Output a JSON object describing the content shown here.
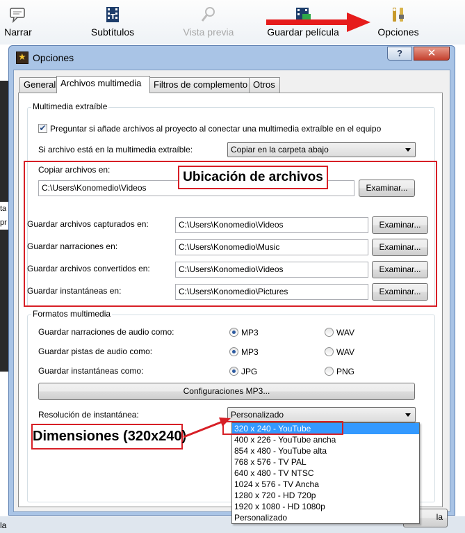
{
  "toolbar": {
    "narrar": "Narrar",
    "subtitulos": "Subtítulos",
    "vista_previa": "Vista previa",
    "guardar_pelicula": "Guardar película",
    "opciones": "Opciones"
  },
  "background": {
    "left_text": "ta\npr",
    "bottom_text": "la",
    "ok_partial": "la"
  },
  "dialog": {
    "title": "Opciones",
    "help": "?",
    "close": "✕",
    "tabs": [
      "General",
      "Archivos multimedia",
      "Filtros de complemento",
      "Otros"
    ],
    "removable": {
      "legend": "Multimedia extraíble",
      "ask_checkbox_label": "Preguntar si añade archivos al proyecto al conectar una multimedia extraíble en el equipo",
      "ask_checked": true,
      "if_file_label": "Si archivo está en la multimedia extraíble:",
      "if_file_value": "Copiar en la carpeta abajo",
      "copy_to_label": "Copiar archivos en:",
      "copy_to_value": "C:\\Users\\Konomedio\\Videos",
      "browse": "Examinar..."
    },
    "paths": [
      {
        "label": "Guardar archivos capturados en:",
        "value": "C:\\Users\\Konomedio\\Videos",
        "browse": "Examinar..."
      },
      {
        "label": "Guardar narraciones en:",
        "value": "C:\\Users\\Konomedio\\Music",
        "browse": "Examinar..."
      },
      {
        "label": "Guardar archivos convertidos en:",
        "value": "C:\\Users\\Konomedio\\Videos",
        "browse": "Examinar..."
      },
      {
        "label": "Guardar instantáneas en:",
        "value": "C:\\Users\\Konomedio\\Pictures",
        "browse": "Examinar..."
      }
    ],
    "formats": {
      "legend": "Formatos multimedia",
      "rows": [
        {
          "label": "Guardar narraciones de audio como:",
          "opt1": "MP3",
          "opt2": "WAV",
          "selected": "opt1"
        },
        {
          "label": "Guardar pistas de audio como:",
          "opt1": "MP3",
          "opt2": "WAV",
          "selected": "opt1"
        },
        {
          "label": "Guardar instantáneas como:",
          "opt1": "JPG",
          "opt2": "PNG",
          "selected": "opt1"
        }
      ],
      "mp3_settings": "Configuraciones MP3...",
      "resolution_label": "Resolución de instantánea:",
      "resolution_value": "Personalizado",
      "resolution_options": [
        "320 x 240 - YouTube",
        "400 x 226 - YouTube ancha",
        "854 x 480 - YouTube alta",
        "768 x 576 - TV PAL",
        "640 x 480 - TV NTSC",
        "1024 x 576 - TV Ancha",
        "1280 x 720 - HD 720p",
        "1920 x 1080 - HD 1080p",
        "Personalizado"
      ],
      "highlighted_option": 0
    }
  },
  "annotations": {
    "ubicacion": "Ubicación de archivos",
    "dimensiones": "Dimensiones (320x240)"
  },
  "colors": {
    "annotation_red": "#d71f26",
    "selection_blue": "#3399ff"
  }
}
